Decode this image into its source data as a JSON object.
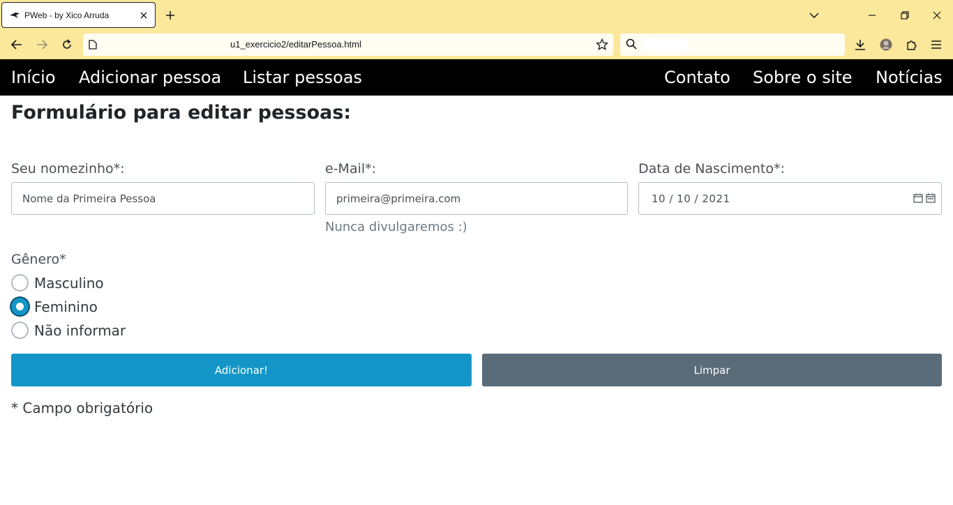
{
  "browser": {
    "tab_title": "PWeb - by Xico Arruda",
    "url": "u1_exercicio2/editarPessoa.html",
    "icons": [
      "bird-favicon-icon",
      "close-tab-icon",
      "new-tab-icon",
      "tab-list-icon",
      "minimize-icon",
      "restore-icon",
      "close-window-icon",
      "back-icon",
      "forward-icon",
      "reload-icon",
      "page-icon",
      "bookmark-star-icon",
      "search-icon",
      "downloads-icon",
      "profile-avatar-icon",
      "extensions-icon",
      "menu-icon"
    ]
  },
  "site_nav": {
    "left": [
      "Início",
      "Adicionar pessoa",
      "Listar pessoas"
    ],
    "right": [
      "Contato",
      "Sobre o site",
      "Notícias"
    ]
  },
  "form": {
    "title": "Formulário para editar pessoas:",
    "name_label": "Seu nomezinho*:",
    "name_value": "Nome da Primeira Pessoa",
    "email_label": "e-Mail*:",
    "email_value": "primeira@primeira.com",
    "email_help": "Nunca divulgaremos :)",
    "birth_label": "Data de Nascimento*:",
    "birth_value": "10 / 10 / 2021",
    "gender_label": "Gênero*",
    "gender_options": [
      "Masculino",
      "Feminino",
      "Não informar"
    ],
    "gender_selected": "Feminino",
    "submit_label": "Adicionar!",
    "reset_label": "Limpar",
    "required_note": "* Campo obrigatório"
  },
  "colors": {
    "chrome_bg": "#fbe89a",
    "nav_bg": "#000000",
    "primary": "#1396c7",
    "secondary": "#5a6b79"
  }
}
